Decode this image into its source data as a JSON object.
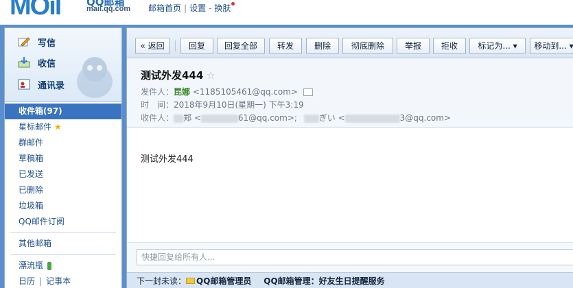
{
  "logo": {
    "big": "MOil",
    "cn": "QQ邮箱",
    "sub": "mail.qq.com"
  },
  "toplinks": {
    "home": "邮箱首页",
    "settings": "设置",
    "skin": "换肤"
  },
  "quick": [
    {
      "label": "写信",
      "icon": "write-icon"
    },
    {
      "label": "收信",
      "icon": "inbox-icon"
    },
    {
      "label": "通讯录",
      "icon": "contacts-icon"
    }
  ],
  "folders": {
    "inbox": "收件箱(97)",
    "starred": "星标邮件",
    "group": "群邮件",
    "drafts": "草稿箱",
    "sent": "已发送",
    "deleted": "已删除",
    "spam": "垃圾箱",
    "subscriptions": "QQ邮件订阅",
    "other": "其他邮箱",
    "bottle": "漂流瓶",
    "calendar": "日历",
    "calendar_sep": "|",
    "notes": "记事本"
  },
  "toolbar": {
    "back": "« 返回",
    "reply": "回复",
    "reply_all": "回复全部",
    "forward": "转发",
    "delete": "删除",
    "delete_perm": "彻底删除",
    "report": "举报",
    "reject": "拒收",
    "mark_as": "标记为... ▾",
    "move_to": "移动到... ▾"
  },
  "email": {
    "subject": "测试外发444",
    "star": "☆",
    "from_label": "发件人：",
    "from_name": "昆娜",
    "from_addr": "<1185105461@qq.com>",
    "time_label": "时　间：",
    "time_value": "2018年9月10日(星期一) 下午3:19",
    "to_label": "收件人：",
    "to_part1": "郑 <",
    "to_part2": "61@qq.com>;",
    "to_part3": "ぎい <",
    "to_part4": "3@qq.com>",
    "body": "测试外发444"
  },
  "reply": {
    "placeholder": "快捷回复给所有人..."
  },
  "next": {
    "label": "下一封未读：",
    "sender": "QQ邮箱管理员",
    "subject": "QQ邮箱管理：好友生日提醒服务"
  },
  "colors": {
    "frame": "#5b8fcc",
    "active_folder": "#3a73bf",
    "sender_green": "#3c8a2c"
  }
}
